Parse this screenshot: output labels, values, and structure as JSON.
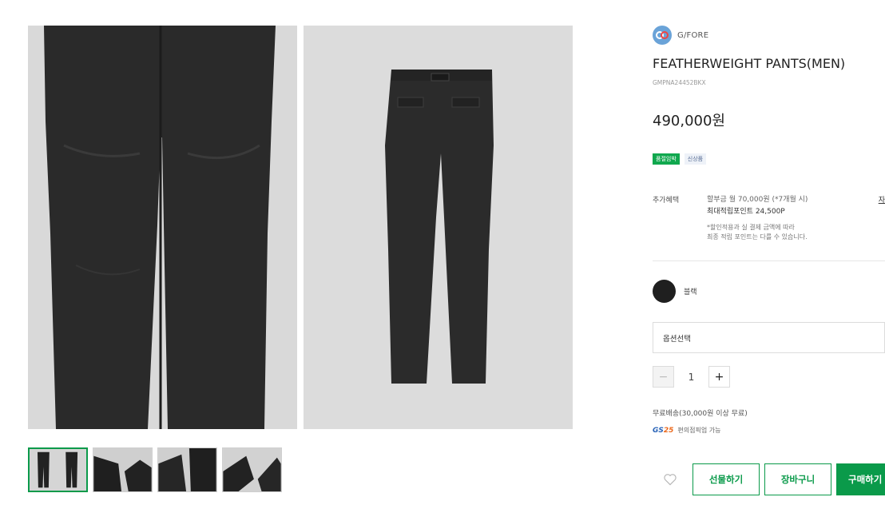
{
  "gallery": {
    "images": [
      {
        "alt_name": "front-pants-image"
      },
      {
        "alt_name": "back-pants-image"
      }
    ],
    "thumbnail_count": 4,
    "active_thumbnail": 0
  },
  "product": {
    "brand": "G/FORE",
    "title": "FEATHERWEIGHT PANTS(MEN)",
    "sku": "GMPNA24452BKX",
    "price": "490,000원",
    "badges": {
      "primary": "품절임박",
      "secondary": "신상품"
    }
  },
  "benefit": {
    "label": "추가혜택",
    "installment": "할부금 월 70,000원 (*7개월 시)",
    "points": "최대적립포인트 24,500P",
    "note_line1": "*할인적용과 실 결제 금액에 따라",
    "note_line2": "최종 적립 포인트는 다를 수 있습니다.",
    "link": "자"
  },
  "color": {
    "name": "블랙",
    "hex": "#1f1f1f"
  },
  "option": {
    "placeholder": "옵션선택"
  },
  "quantity": {
    "minus": "−",
    "value": "1",
    "plus": "+"
  },
  "shipping": {
    "text": "무료배송(30,000원 이상 무료)",
    "gs_logo": "GS",
    "gs_logo_num": "25",
    "gs_text": "편의점픽업 가능"
  },
  "actions": {
    "gift": "선물하기",
    "cart": "장바구니",
    "buy": "구매하기"
  },
  "colors": {
    "accent": "#0a9a4a",
    "badge_green": "#10a84e"
  }
}
